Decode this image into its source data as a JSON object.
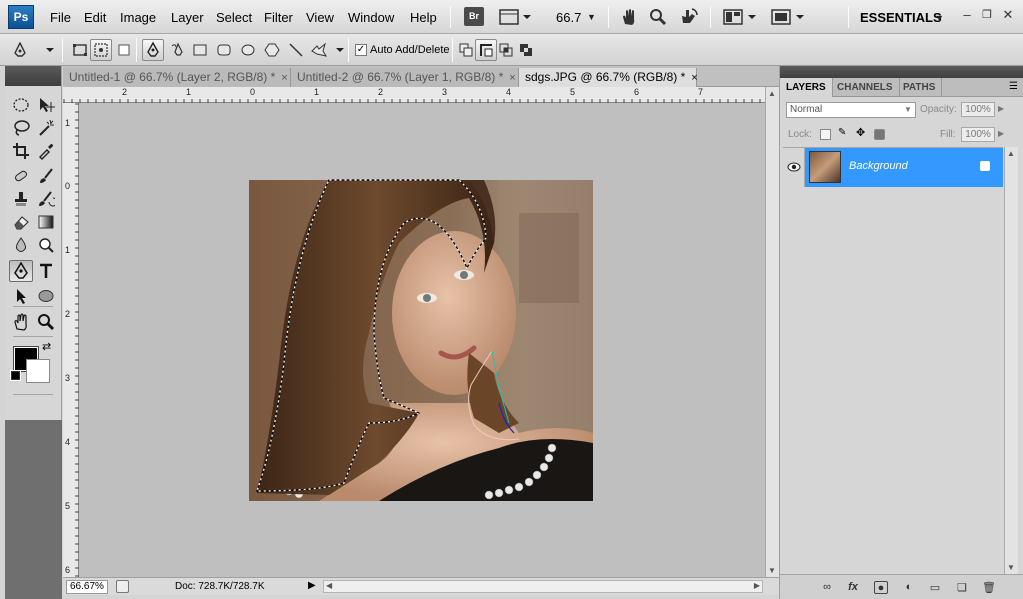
{
  "app": {
    "logo": "Ps",
    "menu": [
      "File",
      "Edit",
      "Image",
      "Layer",
      "Select",
      "Filter",
      "View",
      "Window",
      "Help"
    ],
    "bridge_label": "Br",
    "zoom_value": "66.7",
    "workspace": "ESSENTIALS"
  },
  "options_bar": {
    "auto_add_delete_label": "Auto Add/Delete",
    "auto_add_delete_checked": "✓"
  },
  "documents": {
    "tabs": [
      {
        "label": "Untitled-1 @ 66.7% (Layer 2, RGB/8) *",
        "active": false
      },
      {
        "label": "Untitled-2 @ 66.7% (Layer 1, RGB/8) *",
        "active": false
      },
      {
        "label": "sdgs.JPG @ 66.7% (RGB/8) *",
        "active": true
      }
    ],
    "close_glyph": "×"
  },
  "rulers": {
    "top": [
      "2",
      "1",
      "0",
      "1",
      "2",
      "3",
      "4",
      "5",
      "6",
      "7"
    ],
    "left": [
      "1",
      "0",
      "1",
      "2",
      "3",
      "4",
      "5",
      "6"
    ]
  },
  "status": {
    "zoom": "66.67%",
    "doc_info": "Doc: 728.7K/728.7K"
  },
  "panels": {
    "tabs": [
      "LAYERS",
      "CHANNELS",
      "PATHS"
    ],
    "blend_mode": "Normal",
    "opacity_label": "Opacity:",
    "opacity_value": "100%",
    "lock_label": "Lock:",
    "fill_label": "Fill:",
    "fill_value": "100%",
    "layers": [
      {
        "name": "Background",
        "selected": true,
        "locked": true
      }
    ],
    "footer_icons": [
      "link-icon",
      "fx-icon",
      "mask-icon",
      "adjustment-icon",
      "group-icon",
      "new-layer-icon",
      "trash-icon"
    ]
  },
  "colors": {
    "selection_blue": "#3399ff",
    "foreground": "#000000",
    "background": "#ffffff"
  }
}
